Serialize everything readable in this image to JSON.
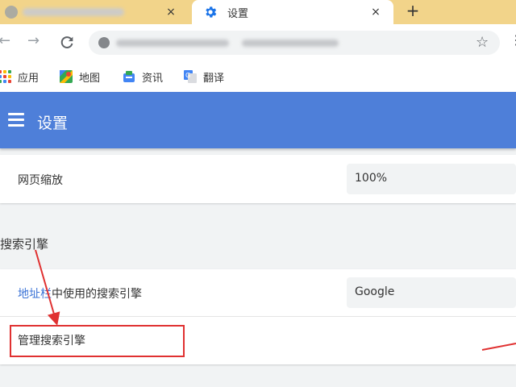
{
  "tabs": [
    {
      "label": "",
      "active": false
    },
    {
      "label": "设置",
      "active": true
    }
  ],
  "icons": {
    "close": "×",
    "new_tab": "+",
    "back": "←",
    "forward": "→",
    "star": "☆",
    "menu": "⋮"
  },
  "bookmarks": [
    {
      "label": "应用",
      "icon": "apps-grid-icon"
    },
    {
      "label": "地图",
      "icon": "maps-icon"
    },
    {
      "label": "资讯",
      "icon": "news-icon"
    },
    {
      "label": "翻译",
      "icon": "translate-icon"
    }
  ],
  "header": {
    "title": "设置",
    "color": "#4e7fd9"
  },
  "appearance": {
    "page_zoom_label": "网页缩放",
    "page_zoom_value": "100%"
  },
  "search_engine": {
    "section_title": "搜索引擎",
    "address_bar_link": "地址栏",
    "address_bar_rest": "中使用的搜索引擎",
    "engine_value": "Google",
    "manage_label": "管理搜索引擎"
  },
  "colors": {
    "tabbar": "#f2d48a",
    "accent": "#4e7fd9",
    "link": "#3b73d6",
    "annotation": "#e03131"
  }
}
